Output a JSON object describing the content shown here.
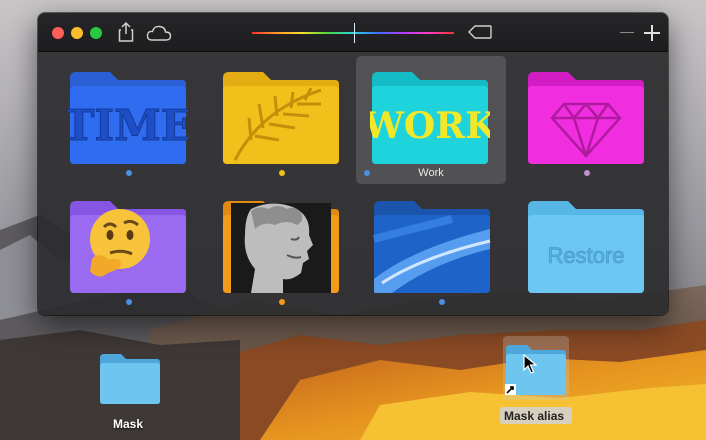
{
  "window": {
    "toolbar_icons": [
      "share-icon",
      "cloud-icon",
      "color-slider",
      "tag-icon",
      "minus-icon",
      "plus-icon"
    ],
    "colors": {
      "close": "#fc5f57",
      "minimize": "#fdbc2e",
      "zoom": "#28c840"
    }
  },
  "grid": {
    "items": [
      {
        "id": "time",
        "label": "",
        "art_text": "TIME",
        "color": "#2f6cf0",
        "dot": "#4a90e2"
      },
      {
        "id": "leaf",
        "label": "",
        "art_text": "",
        "color": "#f2c01a",
        "dot": "#f2c01a"
      },
      {
        "id": "work",
        "label": "Work",
        "art_text": "WORK",
        "color": "#1fd3dc",
        "dot": "#4a90e2",
        "selected": true
      },
      {
        "id": "diamond",
        "label": "",
        "art_text": "",
        "color": "#f02ee0",
        "dot": "#c08fd0"
      },
      {
        "id": "thinking",
        "label": "",
        "art_text": "",
        "color": "#9a6bf0",
        "dot": "#4a90e2"
      },
      {
        "id": "statue",
        "label": "",
        "art_text": "",
        "color": "#f29a1a",
        "dot": "#f29a1a"
      },
      {
        "id": "blue-wallpaper",
        "label": "",
        "art_text": "",
        "color": "#1e63c8",
        "dot": "#4a90e2"
      },
      {
        "id": "restore",
        "label": "",
        "art_text": "Restore",
        "color": "#6cc8f2",
        "dot": "#6cc8f2"
      }
    ]
  },
  "desktop": {
    "mask_label": "Mask",
    "mask_alias_label": "Mask alias"
  }
}
